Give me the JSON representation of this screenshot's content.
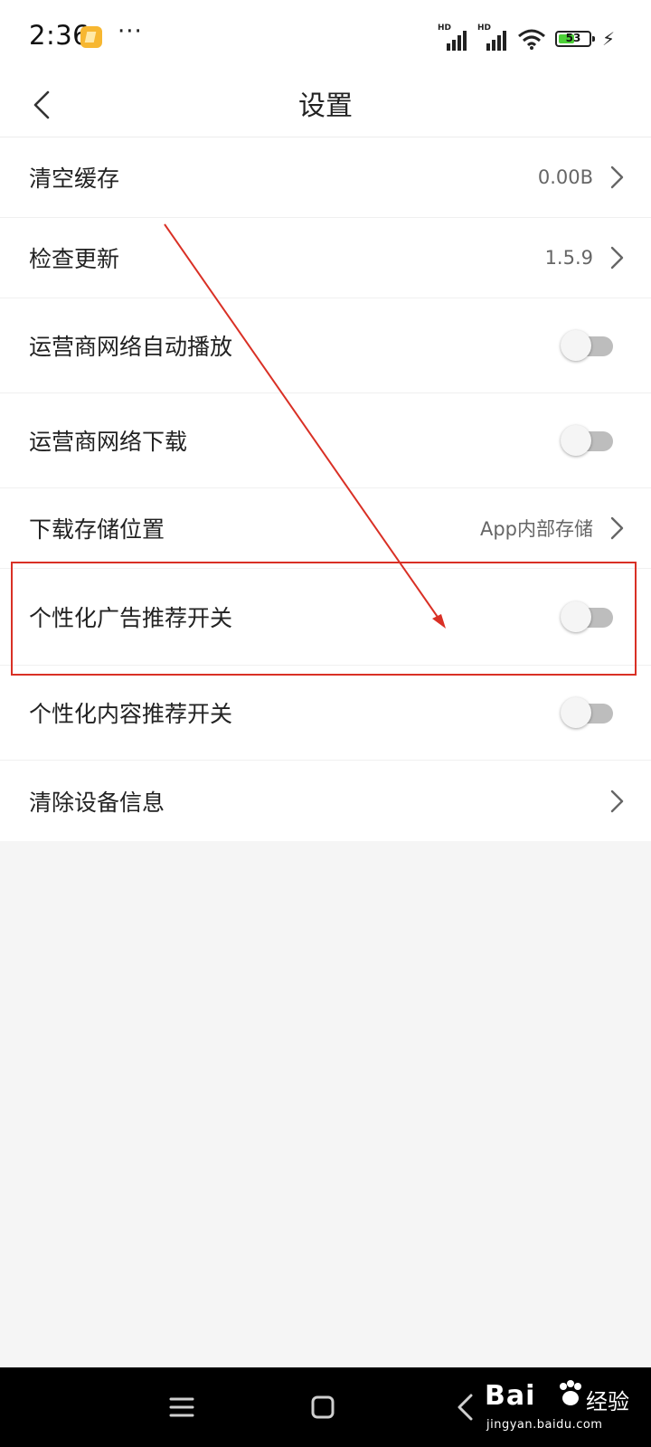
{
  "status_bar": {
    "time": "2:36",
    "more": "···",
    "network_label": "HD",
    "battery_level": "53",
    "battery_fraction": 0.53,
    "icons": [
      "notification-app-icon",
      "signal-icon",
      "wifi-icon",
      "battery-icon",
      "charging-icon"
    ]
  },
  "header": {
    "title": "设置",
    "back_icon": "chevron-left-icon"
  },
  "settings": {
    "items": [
      {
        "label": "清空缓存",
        "value": "0.00B",
        "control": "chevron"
      },
      {
        "label": "检查更新",
        "value": "1.5.9",
        "control": "chevron"
      },
      {
        "label": "运营商网络自动播放",
        "control": "toggle",
        "on": false
      },
      {
        "label": "运营商网络下载",
        "control": "toggle",
        "on": false
      },
      {
        "label": "下载存储位置",
        "value": "App内部存储",
        "control": "chevron"
      },
      {
        "label": "个性化广告推荐开关",
        "control": "toggle",
        "on": false,
        "highlighted": true
      },
      {
        "label": "个性化内容推荐开关",
        "control": "toggle",
        "on": false
      },
      {
        "label": "清除设备信息",
        "control": "chevron"
      }
    ]
  },
  "annotation": {
    "color": "#d93025"
  },
  "nav_bar": {
    "icons": [
      "menu-icon",
      "home-icon",
      "back-icon"
    ]
  },
  "watermark": {
    "brand": "Bai",
    "product": "经验",
    "url": "jingyan.baidu.com"
  }
}
